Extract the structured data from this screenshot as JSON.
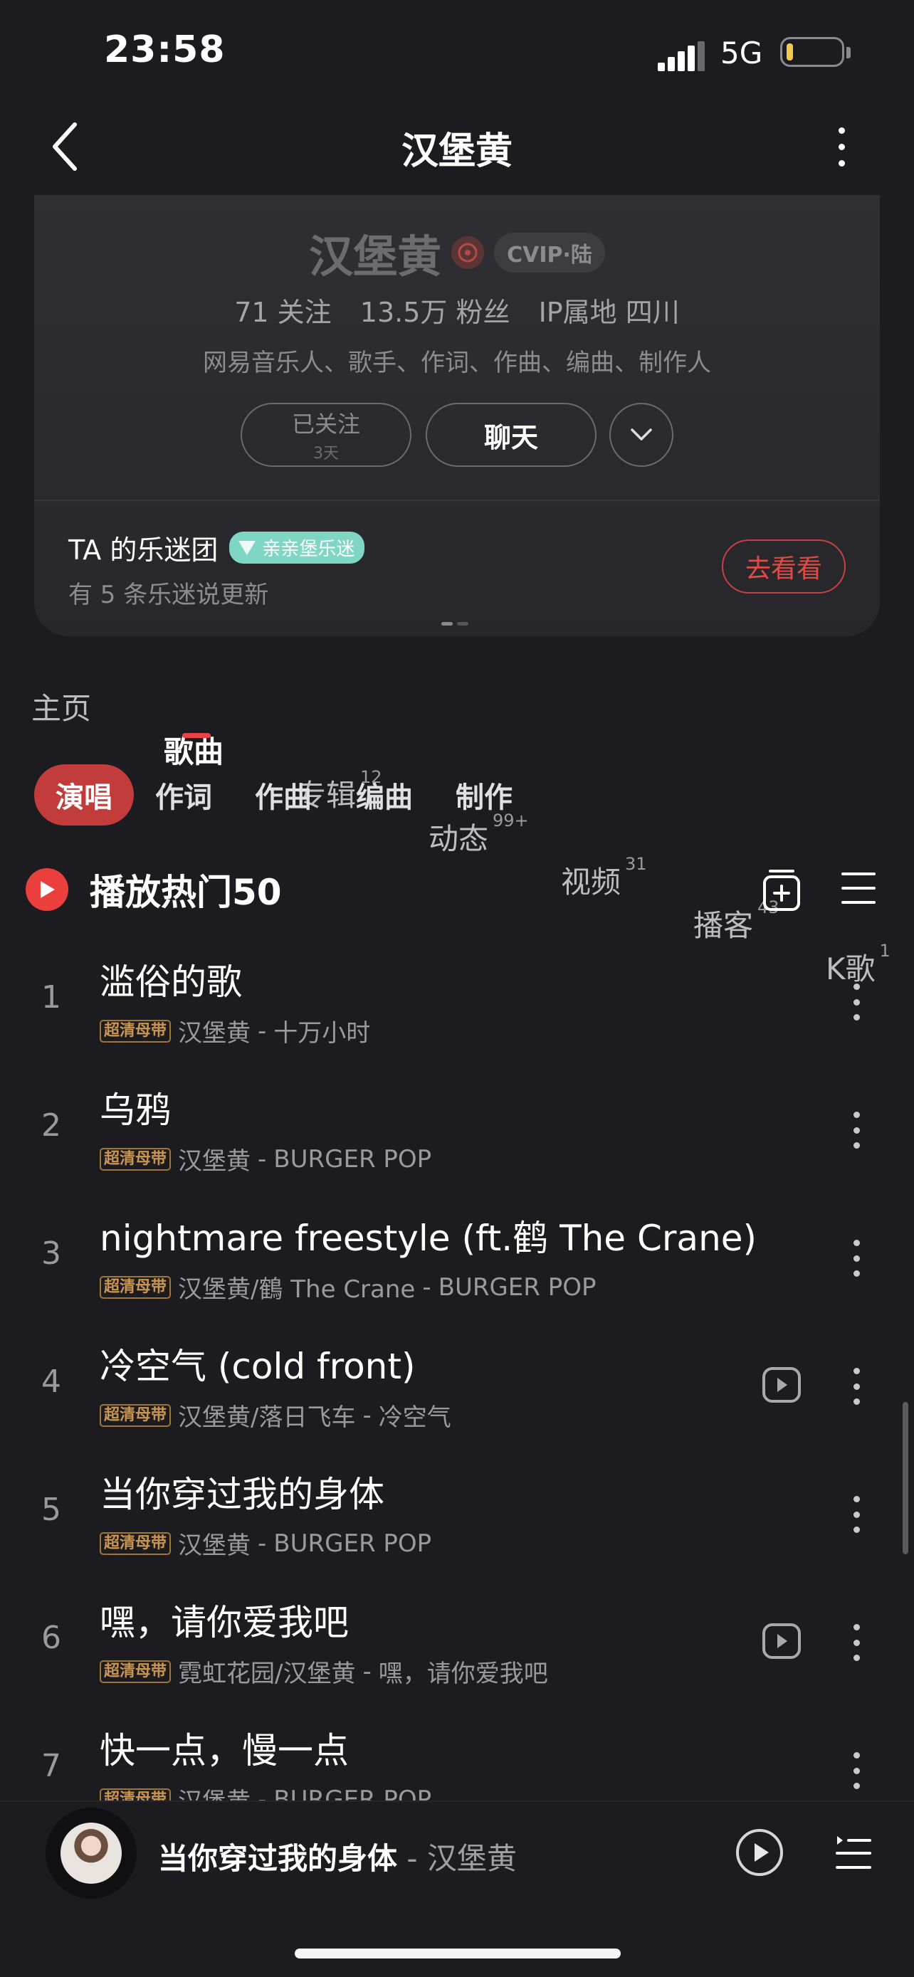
{
  "status_bar": {
    "time": "23:58",
    "network": "5G",
    "battery_level": 0.12
  },
  "nav": {
    "title": "汉堡黄"
  },
  "profile": {
    "name": "汉堡黄",
    "vip_badge": "CVIP·陆",
    "follows": "71 关注",
    "fans": "13.5万 粉丝",
    "ip": "IP属地 四川",
    "tags": "网易音乐人、歌手、作词、作曲、编曲、制作人",
    "follow_label": "已关注",
    "follow_days": "3天",
    "chat_label": "聊天"
  },
  "fan_group": {
    "title": "TA 的乐迷团",
    "badge": "亲亲堡乐迷",
    "subtitle": "有 5 条乐迷说更新",
    "button": "去看看"
  },
  "tabs": [
    {
      "label": "主页",
      "count": ""
    },
    {
      "label": "歌曲",
      "count": ""
    },
    {
      "label": "专辑",
      "count": "12"
    },
    {
      "label": "动态",
      "count": "99+"
    },
    {
      "label": "视频",
      "count": "31"
    },
    {
      "label": "播客",
      "count": "43"
    },
    {
      "label": "K歌",
      "count": "1"
    }
  ],
  "filters": [
    "演唱",
    "作词",
    "作曲",
    "编曲",
    "制作"
  ],
  "section": {
    "title": "播放热门50"
  },
  "quality_tag": "超清母带",
  "songs": [
    {
      "rank": "1",
      "title": "滥俗的歌",
      "artist": "汉堡黄",
      "album": "十万小时",
      "has_video": false
    },
    {
      "rank": "2",
      "title": "乌鸦",
      "artist": "汉堡黄",
      "album": "BURGER POP",
      "has_video": false
    },
    {
      "rank": "3",
      "title": "nightmare freestyle (ft.鹤 The Crane)",
      "artist": "汉堡黄/鶴 The Crane",
      "album": "BURGER POP",
      "has_video": false
    },
    {
      "rank": "4",
      "title": "冷空气 (cold front)",
      "artist": "汉堡黄/落日飞车",
      "album": "冷空气",
      "has_video": true
    },
    {
      "rank": "5",
      "title": "当你穿过我的身体",
      "artist": "汉堡黄",
      "album": "BURGER POP",
      "has_video": false
    },
    {
      "rank": "6",
      "title": "嘿，请你爱我吧",
      "artist": "霓虹花园/汉堡黄",
      "album": "嘿，请你爱我吧",
      "has_video": true
    },
    {
      "rank": "7",
      "title": "快一点，慢一点",
      "artist": "汉堡黄",
      "album": "BURGER POP",
      "has_video": false
    }
  ],
  "player": {
    "title": "当你穿过我的身体",
    "separator": " - ",
    "artist": "汉堡黄"
  },
  "colors": {
    "accent": "#e7414a",
    "background": "#1c1c20",
    "quality": "#c99552"
  }
}
